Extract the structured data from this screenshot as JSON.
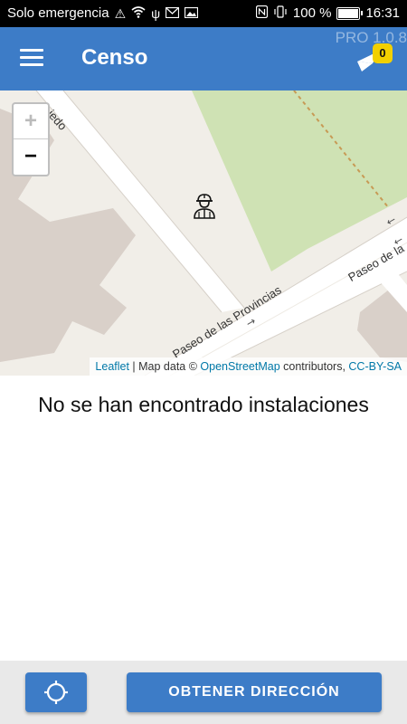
{
  "status_bar": {
    "carrier": "Solo emergencia",
    "battery": "100 %",
    "time": "16:31"
  },
  "app_bar": {
    "title": "Censo",
    "version": "PRO 1.0.8",
    "notification_count": "0"
  },
  "map": {
    "street_labels": [
      "Paseo de las Provincias",
      "Paseo de la",
      "iedo"
    ],
    "attribution": {
      "leaflet": "Leaflet",
      "separator": " | Map data © ",
      "osm": "OpenStreetMap",
      "contributors": " contributors, ",
      "license": "CC-BY-SA"
    },
    "zoom_in": "+",
    "zoom_out": "−"
  },
  "main": {
    "empty_message": "No se han encontrado instalaciones"
  },
  "bottom_bar": {
    "address_button": "OBTENER DIRECCIÓN"
  },
  "colors": {
    "primary": "#3d7cc7",
    "badge": "#f2d000"
  }
}
